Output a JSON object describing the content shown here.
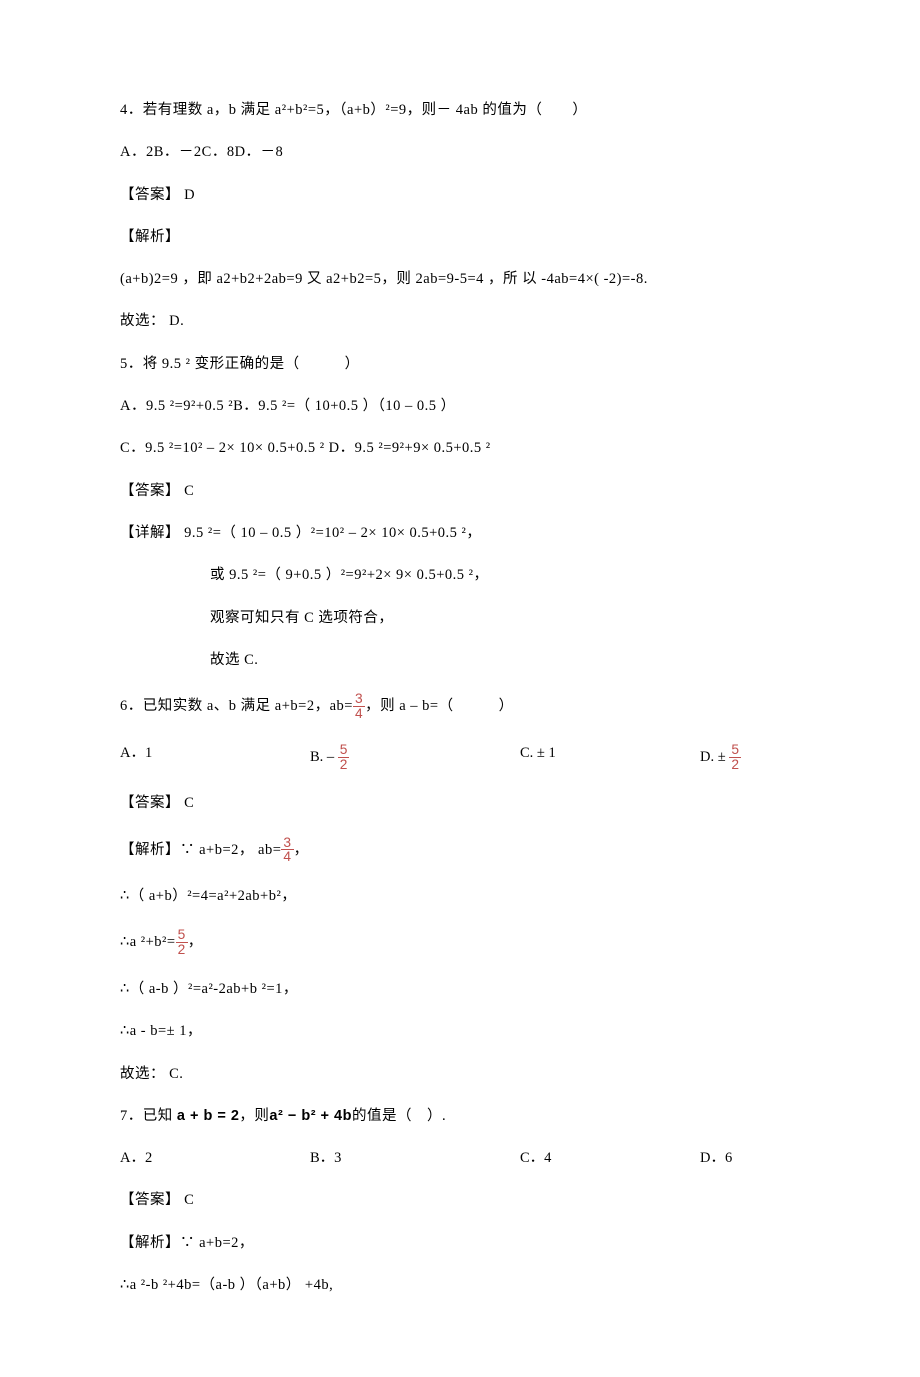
{
  "q4": {
    "text": "4．若有理数  a，b 满足 a²+b²=5，（a+b）²=9，则－ 4ab 的值为（　　）",
    "options": "A．2B．－2C．8D．－8",
    "answer": "【答案】 D",
    "analysis_label": "【解析】",
    "analysis1": "(a+b)2=9 ，即   a2+b2+2ab=9  又   a2+b2=5，则  2ab=9-5=4 ，所 以 -4ab=4×(  -2)=-8.",
    "analysis2": "故选： D."
  },
  "q5": {
    "text": "5．将  9.5 ² 变形正确的是（　　　）",
    "optA": "A．9.5 ²=9²+0.5 ²B．9.5 ²=（ 10+0.5 ）（10 – 0.5 ）",
    "optC": "C．9.5 ²=10² – 2× 10× 0.5+0.5  ² D．9.5 ²=9²+9× 0.5+0.5  ²",
    "answer": "【答案】 C",
    "detail1": "【详解】 9.5 ²=（ 10 – 0.5 ）²=10² – 2× 10× 0.5+0.5  ²，",
    "detail2": "或 9.5 ²=（ 9+0.5 ）²=9²+2× 9× 0.5+0.5  ²，",
    "detail3": "观察可知只有   C 选项符合，",
    "detail4": "故选  C."
  },
  "q6": {
    "text_pre": "6．已知实数  a、b 满足 a+b=2，ab=",
    "text_mid": "，则 a – b=（　　　）",
    "optA": "A．1",
    "optB_pre": "B. –",
    "optC": "C. ± 1",
    "optD_pre": "D. ±",
    "answer": "【答案】 C",
    "an1_pre": "【解析】∵ a+b=2，  ab=",
    "an1_post": "，",
    "an2": "∴（ a+b）²=4=a²+2ab+b²，",
    "an3_pre": "∴a ²+b²=",
    "an3_post": "，",
    "an4": "∴（ a-b ）²=a²-2ab+b ²=1，",
    "an5": "∴a - b=± 1，",
    "an6": "故选： C."
  },
  "q7": {
    "text_pre": "7．已知 ",
    "expr1": "a + b = 2",
    "text_mid": "，则",
    "expr2": "a² − b² + 4b",
    "text_post": "的值是（　）.",
    "optA": "A．2",
    "optB": "B．3",
    "optC": "C．4",
    "optD": "D．6",
    "answer": "【答案】 C",
    "an1": "【解析】∵ a+b=2，",
    "an2": "∴a ²-b ²+4b=（a-b ）（a+b）  +4b,"
  },
  "frac34": {
    "num": "3",
    "den": "4"
  },
  "frac52": {
    "num": "5",
    "den": "2"
  }
}
